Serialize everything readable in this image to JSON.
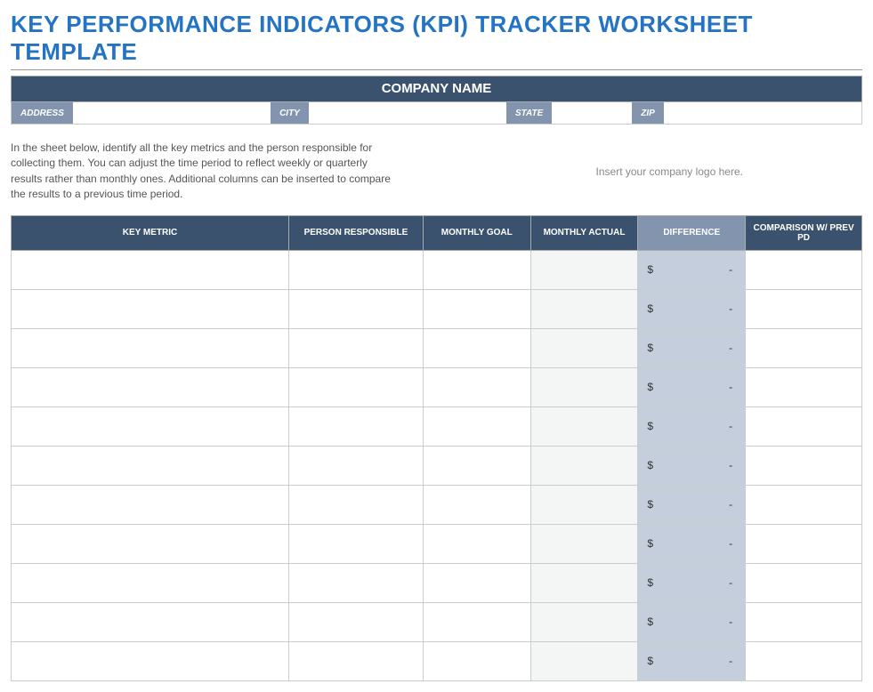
{
  "title": "KEY PERFORMANCE INDICATORS (KPI) TRACKER WORKSHEET TEMPLATE",
  "company_bar": "COMPANY NAME",
  "address_labels": {
    "address": "ADDRESS",
    "city": "CITY",
    "state": "STATE",
    "zip": "ZIP"
  },
  "address_values": {
    "address": "",
    "city": "",
    "state": "",
    "zip": ""
  },
  "instructions": "In the sheet below, identify all the key metrics and the person responsible for collecting them. You can adjust the time period to reflect weekly or quarterly results rather than monthly ones. Additional columns can be inserted to compare the results to a previous time period.",
  "logo_placeholder": "Insert your company logo here.",
  "table": {
    "headers": {
      "key_metric": "KEY METRIC",
      "person": "PERSON RESPONSIBLE",
      "goal": "MONTHLY GOAL",
      "actual": "MONTHLY ACTUAL",
      "difference": "DIFFERENCE",
      "comparison": "COMPARISON W/ PREV PD"
    },
    "currency_symbol": "$",
    "dash": "-",
    "rows": [
      {
        "key_metric": "",
        "person": "",
        "goal": "",
        "actual": "",
        "difference": "-",
        "comparison": ""
      },
      {
        "key_metric": "",
        "person": "",
        "goal": "",
        "actual": "",
        "difference": "-",
        "comparison": ""
      },
      {
        "key_metric": "",
        "person": "",
        "goal": "",
        "actual": "",
        "difference": "-",
        "comparison": ""
      },
      {
        "key_metric": "",
        "person": "",
        "goal": "",
        "actual": "",
        "difference": "-",
        "comparison": ""
      },
      {
        "key_metric": "",
        "person": "",
        "goal": "",
        "actual": "",
        "difference": "-",
        "comparison": ""
      },
      {
        "key_metric": "",
        "person": "",
        "goal": "",
        "actual": "",
        "difference": "-",
        "comparison": ""
      },
      {
        "key_metric": "",
        "person": "",
        "goal": "",
        "actual": "",
        "difference": "-",
        "comparison": ""
      },
      {
        "key_metric": "",
        "person": "",
        "goal": "",
        "actual": "",
        "difference": "-",
        "comparison": ""
      },
      {
        "key_metric": "",
        "person": "",
        "goal": "",
        "actual": "",
        "difference": "-",
        "comparison": ""
      },
      {
        "key_metric": "",
        "person": "",
        "goal": "",
        "actual": "",
        "difference": "-",
        "comparison": ""
      },
      {
        "key_metric": "",
        "person": "",
        "goal": "",
        "actual": "",
        "difference": "-",
        "comparison": ""
      }
    ]
  }
}
